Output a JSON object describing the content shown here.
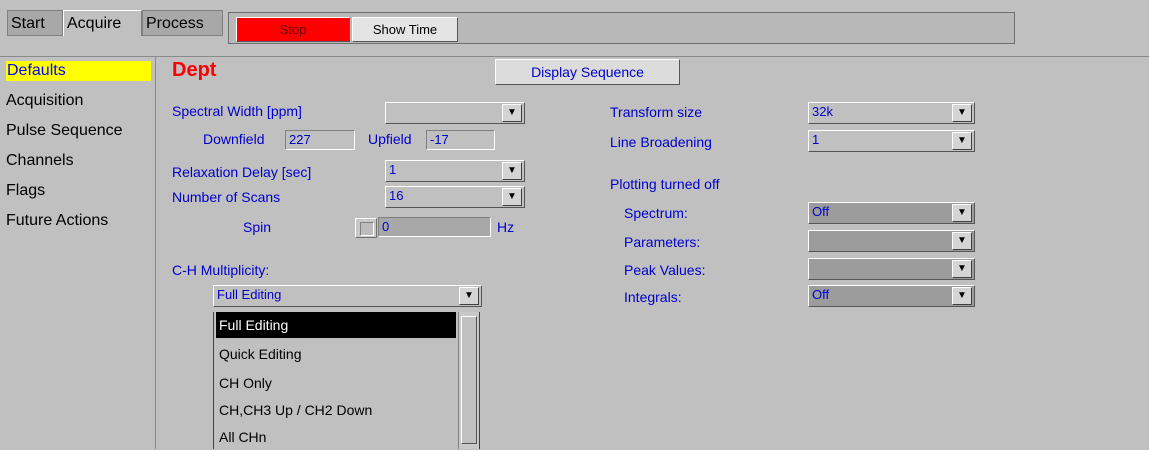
{
  "tabs": [
    "Start",
    "Acquire",
    "Process"
  ],
  "toolbar": {
    "stop_label": "Stop",
    "show_time_label": "Show Time"
  },
  "sidebar": {
    "items": [
      "Defaults",
      "Acquisition",
      "Pulse Sequence",
      "Channels",
      "Flags",
      "Future Actions"
    ],
    "selected": "Defaults"
  },
  "main": {
    "title": "Dept",
    "display_sequence_label": "Display Sequence",
    "spectral_width_label": "Spectral Width [ppm]",
    "spectral_width_value": "",
    "downfield_label": "Downfield",
    "downfield_value": "227",
    "upfield_label": "Upfield",
    "upfield_value": "-17",
    "relaxation_delay_label": "Relaxation Delay [sec]",
    "relaxation_delay_value": "1",
    "number_of_scans_label": "Number of Scans",
    "number_of_scans_value": "16",
    "spin_label": "Spin",
    "spin_value": "0",
    "spin_unit": "Hz",
    "multiplicity_label": "C-H Multiplicity:",
    "multiplicity_value": "Full Editing",
    "multiplicity_options": [
      "Full Editing",
      "Quick Editing",
      "CH Only",
      "CH,CH3 Up / CH2 Down",
      "All CHn"
    ],
    "transform_size_label": "Transform size",
    "transform_size_value": "32k",
    "line_broadening_label": "Line Broadening",
    "line_broadening_value": "1",
    "plotting_label": "Plotting turned off",
    "spectrum_label": "Spectrum:",
    "spectrum_value": "Off",
    "parameters_label": "Parameters:",
    "parameters_value": "",
    "peak_values_label": "Peak Values:",
    "peak_values_value": "",
    "integrals_label": "Integrals:",
    "integrals_value": "Off"
  },
  "colors": {
    "background": "#c0c0c0",
    "label_blue": "#0000cc",
    "title_red": "#ff0000",
    "selected_yellow": "#ffff00",
    "stop_red": "#ff0000"
  }
}
